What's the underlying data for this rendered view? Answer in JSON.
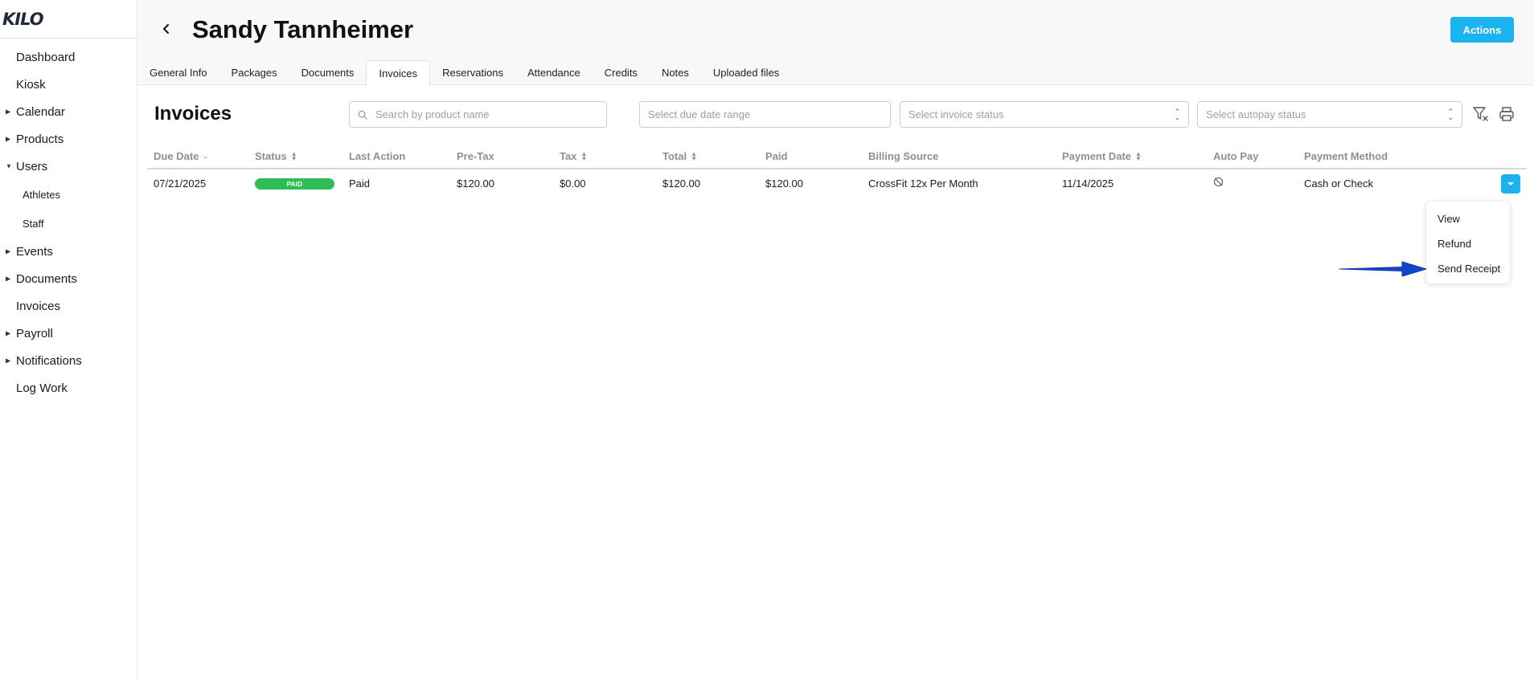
{
  "app": {
    "logo": "KILO"
  },
  "sidebar": {
    "items": [
      {
        "label": "Dashboard",
        "caret": false
      },
      {
        "label": "Kiosk",
        "caret": false
      },
      {
        "label": "Calendar",
        "caret": "right"
      },
      {
        "label": "Products",
        "caret": "right"
      },
      {
        "label": "Users",
        "caret": "down"
      },
      {
        "label": "Athletes",
        "sub": true
      },
      {
        "label": "Staff",
        "sub": true
      },
      {
        "label": "Events",
        "caret": "right"
      },
      {
        "label": "Documents",
        "caret": "right"
      },
      {
        "label": "Invoices",
        "caret": false
      },
      {
        "label": "Payroll",
        "caret": "right"
      },
      {
        "label": "Notifications",
        "caret": "right"
      },
      {
        "label": "Log Work",
        "caret": false
      }
    ]
  },
  "header": {
    "title": "Sandy Tannheimer",
    "actions_label": "Actions",
    "tabs": [
      {
        "label": "General Info"
      },
      {
        "label": "Packages"
      },
      {
        "label": "Documents"
      },
      {
        "label": "Invoices",
        "active": true
      },
      {
        "label": "Reservations"
      },
      {
        "label": "Attendance"
      },
      {
        "label": "Credits"
      },
      {
        "label": "Notes"
      },
      {
        "label": "Uploaded files"
      }
    ]
  },
  "invoices": {
    "title": "Invoices",
    "filters": {
      "search_placeholder": "Search by product name",
      "due_date_placeholder": "Select due date range",
      "invoice_status_placeholder": "Select invoice status",
      "autopay_status_placeholder": "Select autopay status"
    },
    "columns": {
      "due_date": "Due Date",
      "status": "Status",
      "last_action": "Last Action",
      "pre_tax": "Pre-Tax",
      "tax": "Tax",
      "total": "Total",
      "paid": "Paid",
      "billing_source": "Billing Source",
      "payment_date": "Payment Date",
      "auto_pay": "Auto Pay",
      "payment_method": "Payment Method"
    },
    "rows": [
      {
        "due_date": "07/21/2025",
        "status": "PAID",
        "last_action": "Paid",
        "pre_tax": "$120.00",
        "tax": "$0.00",
        "total": "$120.00",
        "paid": "$120.00",
        "billing_source": "CrossFit 12x Per Month",
        "payment_date": "11/14/2025",
        "auto_pay": "autopay-off-icon",
        "payment_method": "Cash or Check"
      }
    ],
    "row_menu": [
      "View",
      "Refund",
      "Send Receipt"
    ]
  },
  "colors": {
    "accent": "#1ab3f0",
    "paid_badge": "#2fbe55",
    "annotation_arrow": "#1246c9"
  }
}
